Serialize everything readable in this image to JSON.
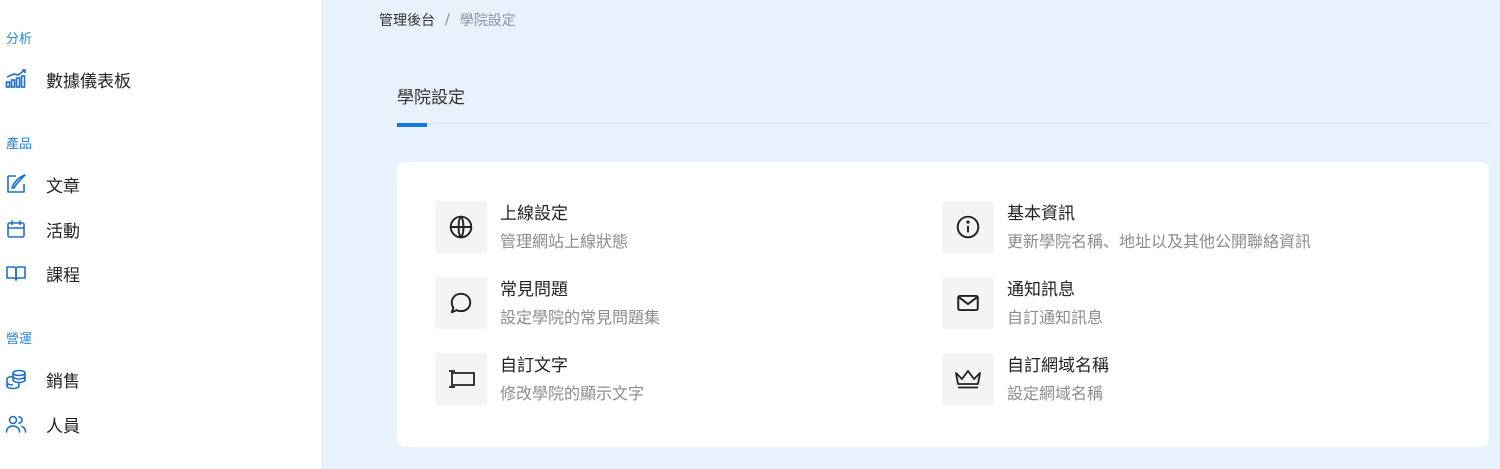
{
  "sidebar": {
    "sections": [
      {
        "title": "分析",
        "items": [
          {
            "label": "數據儀表板",
            "icon": "chart-bars-icon"
          }
        ]
      },
      {
        "title": "產品",
        "items": [
          {
            "label": "文章",
            "icon": "edit-icon"
          },
          {
            "label": "活動",
            "icon": "calendar-icon"
          },
          {
            "label": "課程",
            "icon": "book-icon"
          }
        ]
      },
      {
        "title": "營運",
        "items": [
          {
            "label": "銷售",
            "icon": "coins-icon"
          },
          {
            "label": "人員",
            "icon": "users-icon"
          }
        ]
      }
    ]
  },
  "breadcrumb": {
    "root": "管理後台",
    "separator": "/",
    "current": "學院設定"
  },
  "page": {
    "title": "學院設定"
  },
  "settings": [
    {
      "title": "上線設定",
      "desc": "管理網站上線狀態",
      "icon": "globe-icon"
    },
    {
      "title": "基本資訊",
      "desc": "更新學院名稱、地址以及其他公開聯絡資訊",
      "icon": "info-icon"
    },
    {
      "title": "常見問題",
      "desc": "設定學院的常見問題集",
      "icon": "chat-bubble-icon"
    },
    {
      "title": "通知訊息",
      "desc": "自訂通知訊息",
      "icon": "mail-icon"
    },
    {
      "title": "自訂文字",
      "desc": "修改學院的顯示文字",
      "icon": "text-field-icon"
    },
    {
      "title": "自訂網域名稱",
      "desc": "設定網域名稱",
      "icon": "crown-icon"
    }
  ],
  "colors": {
    "accent": "#1677e8",
    "section": "#2a86d6",
    "background": "#e8f2fc"
  }
}
